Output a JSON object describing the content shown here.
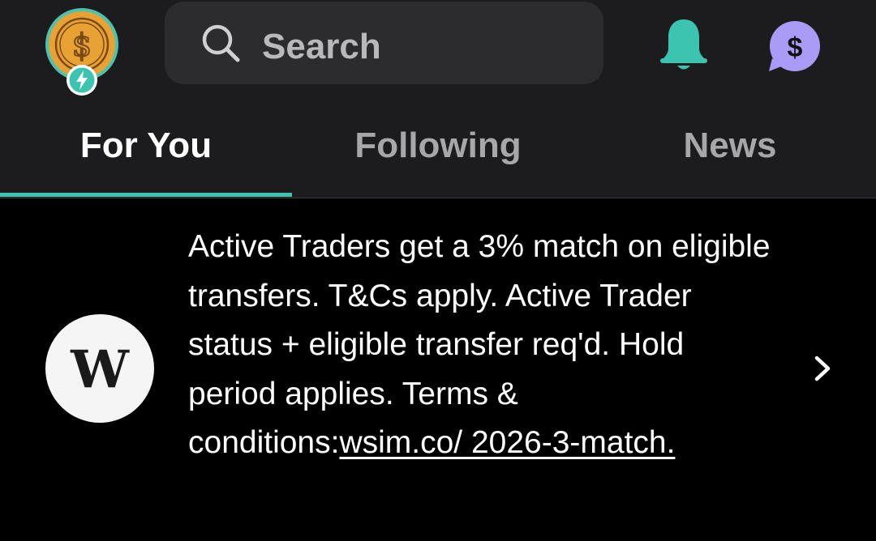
{
  "header": {
    "avatar_icon": "dollar-coin-avatar",
    "avatar_badge_icon": "lightning-icon",
    "search": {
      "placeholder": "Search",
      "icon": "search-icon"
    },
    "notifications_icon": "bell-icon",
    "notifications_color": "#3cc4b1",
    "messages_icon": "dollar-chat-icon",
    "messages_color": "#a99bf6"
  },
  "tabs": [
    {
      "label": "For You",
      "active": true
    },
    {
      "label": "Following",
      "active": false
    },
    {
      "label": "News",
      "active": false
    }
  ],
  "accent_color": "#3cc4b1",
  "promo": {
    "logo_letter": "W",
    "text": "Active Traders get a 3% match on eligible transfers. T&Cs apply. Active Trader status + eligible transfer req'd. Hold period applies. Terms & conditions:",
    "link_text": "wsim.co/ 2026-3-match.",
    "chevron_icon": "chevron-right-icon"
  }
}
